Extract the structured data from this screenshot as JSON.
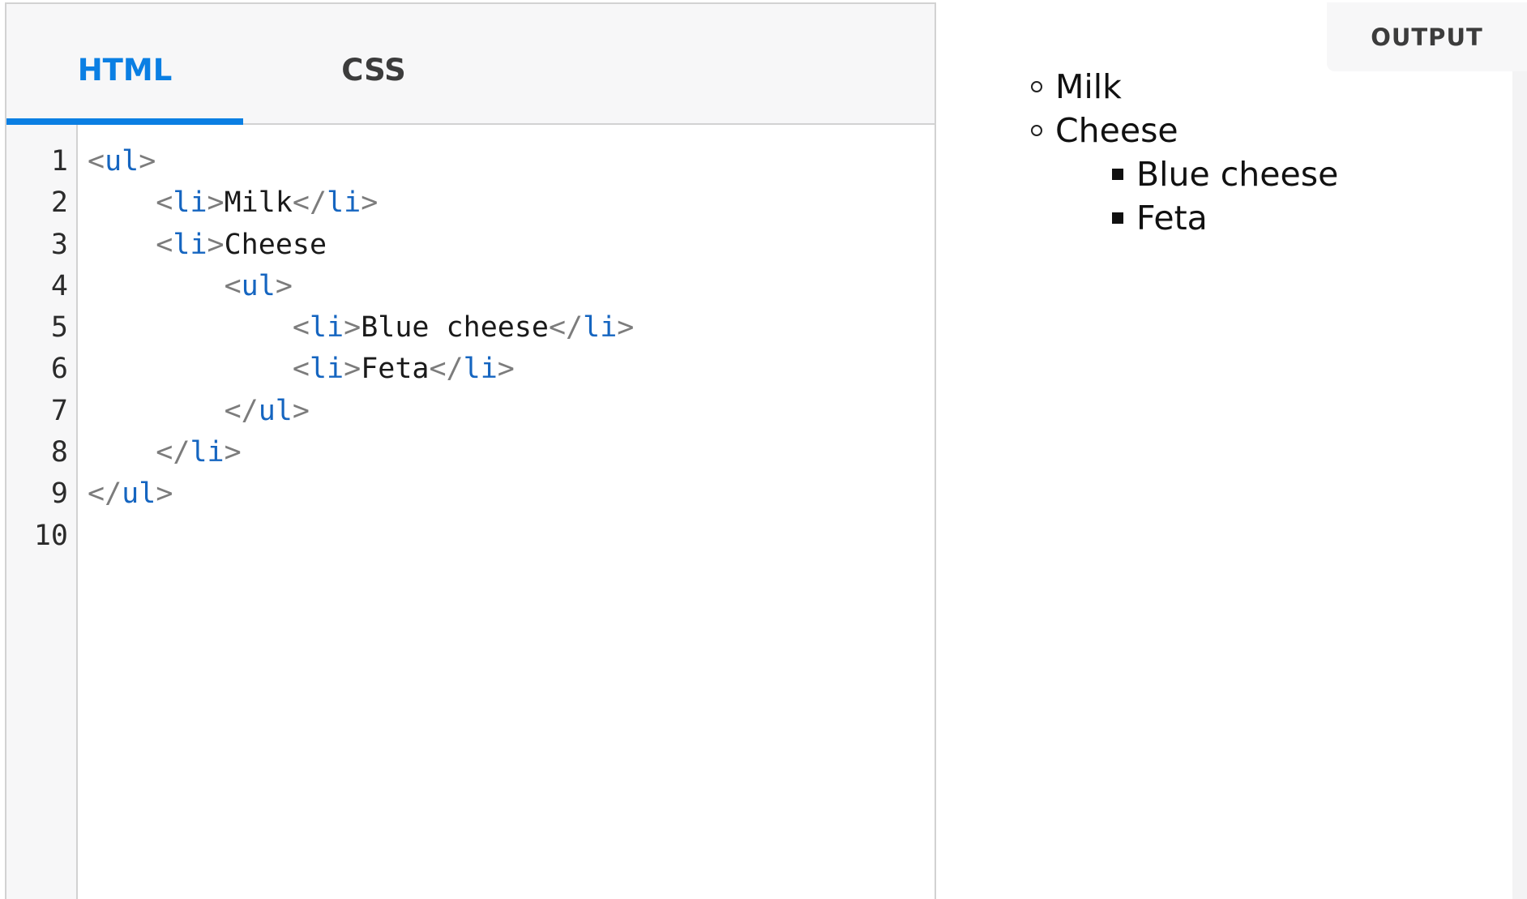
{
  "tabs": [
    {
      "label": "HTML",
      "active": true
    },
    {
      "label": "CSS",
      "active": false
    }
  ],
  "editor": {
    "line_numbers": [
      "1",
      "2",
      "3",
      "4",
      "5",
      "6",
      "7",
      "8",
      "9",
      "10"
    ],
    "lines": [
      [
        {
          "k": "punct",
          "t": "<"
        },
        {
          "k": "tag",
          "t": "ul"
        },
        {
          "k": "punct",
          "t": ">"
        }
      ],
      [
        {
          "k": "text",
          "t": "    "
        },
        {
          "k": "punct",
          "t": "<"
        },
        {
          "k": "tag",
          "t": "li"
        },
        {
          "k": "punct",
          "t": ">"
        },
        {
          "k": "text",
          "t": "Milk"
        },
        {
          "k": "punct",
          "t": "</"
        },
        {
          "k": "tag",
          "t": "li"
        },
        {
          "k": "punct",
          "t": ">"
        }
      ],
      [
        {
          "k": "text",
          "t": "    "
        },
        {
          "k": "punct",
          "t": "<"
        },
        {
          "k": "tag",
          "t": "li"
        },
        {
          "k": "punct",
          "t": ">"
        },
        {
          "k": "text",
          "t": "Cheese"
        }
      ],
      [
        {
          "k": "text",
          "t": "        "
        },
        {
          "k": "punct",
          "t": "<"
        },
        {
          "k": "tag",
          "t": "ul"
        },
        {
          "k": "punct",
          "t": ">"
        }
      ],
      [
        {
          "k": "text",
          "t": "            "
        },
        {
          "k": "punct",
          "t": "<"
        },
        {
          "k": "tag",
          "t": "li"
        },
        {
          "k": "punct",
          "t": ">"
        },
        {
          "k": "text",
          "t": "Blue cheese"
        },
        {
          "k": "punct",
          "t": "</"
        },
        {
          "k": "tag",
          "t": "li"
        },
        {
          "k": "punct",
          "t": ">"
        }
      ],
      [
        {
          "k": "text",
          "t": "            "
        },
        {
          "k": "punct",
          "t": "<"
        },
        {
          "k": "tag",
          "t": "li"
        },
        {
          "k": "punct",
          "t": ">"
        },
        {
          "k": "text",
          "t": "Feta"
        },
        {
          "k": "punct",
          "t": "</"
        },
        {
          "k": "tag",
          "t": "li"
        },
        {
          "k": "punct",
          "t": ">"
        }
      ],
      [
        {
          "k": "text",
          "t": "        "
        },
        {
          "k": "punct",
          "t": "</"
        },
        {
          "k": "tag",
          "t": "ul"
        },
        {
          "k": "punct",
          "t": ">"
        }
      ],
      [
        {
          "k": "text",
          "t": "    "
        },
        {
          "k": "punct",
          "t": "</"
        },
        {
          "k": "tag",
          "t": "li"
        },
        {
          "k": "punct",
          "t": ">"
        }
      ],
      [
        {
          "k": "punct",
          "t": "</"
        },
        {
          "k": "tag",
          "t": "ul"
        },
        {
          "k": "punct",
          "t": ">"
        }
      ],
      []
    ]
  },
  "output": {
    "label": "OUTPUT",
    "items": [
      {
        "text": "Milk",
        "level": 1,
        "bullet": "circle"
      },
      {
        "text": "Cheese",
        "level": 1,
        "bullet": "circle"
      },
      {
        "text": "Blue cheese",
        "level": 2,
        "bullet": "square"
      },
      {
        "text": "Feta",
        "level": 2,
        "bullet": "square"
      }
    ]
  },
  "colors": {
    "accent": "#0b7fe3",
    "tag": "#1565c0",
    "punct": "#7c7c7c",
    "panel_bg": "#f7f7f8"
  }
}
